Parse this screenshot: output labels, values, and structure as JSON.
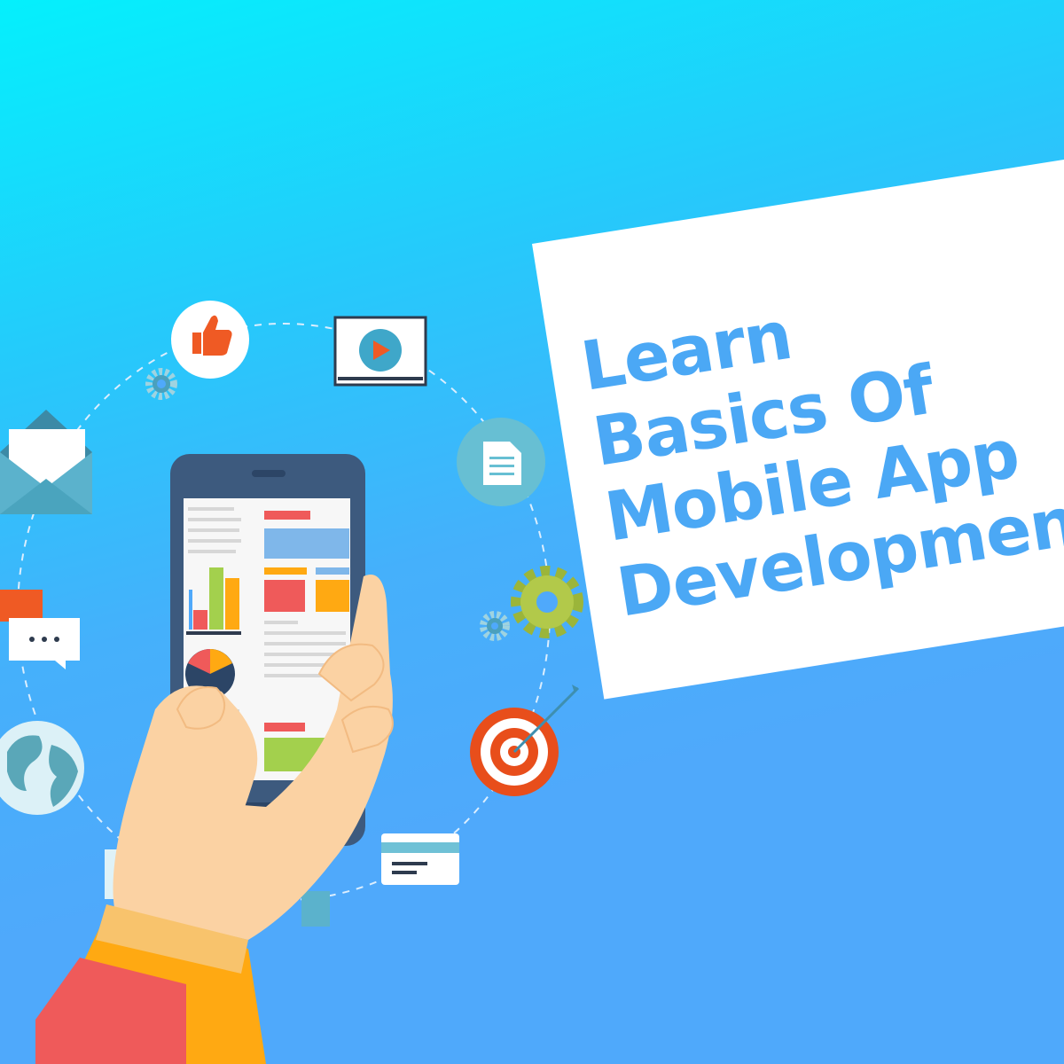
{
  "title_lines": [
    "Learn",
    "Basics Of",
    "Mobile App",
    "Development"
  ],
  "icons": [
    "thumbs-up-icon",
    "video-player-icon",
    "envelope-icon",
    "document-icon",
    "gear-icon",
    "chat-bubble-icon",
    "globe-icon",
    "target-icon",
    "credit-card-icon",
    "camera-icon"
  ],
  "colors": {
    "background_top": "#04f0fc",
    "background_bottom": "#4fa9fb",
    "title_text": "#4ba8f5",
    "card": "#ffffff"
  }
}
